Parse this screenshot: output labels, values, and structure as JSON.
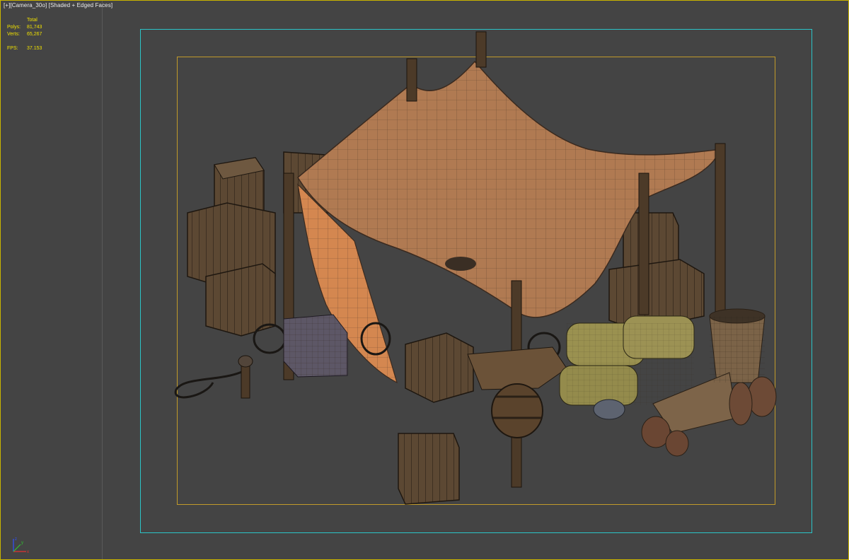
{
  "viewport": {
    "header": {
      "plus_label": "[+]",
      "camera_label": "[Camera_30o]",
      "shading_label": "[Shaded + Edged Faces]"
    },
    "stats": {
      "total_label": "Total",
      "polys_label": "Polys:",
      "polys_value": "81,743",
      "verts_label": "Verts:",
      "verts_value": "65,267",
      "fps_label": "FPS:",
      "fps_value": "37.153"
    },
    "axis_gizmo": {
      "x_label": "x",
      "y_label": "y",
      "z_label": "z"
    }
  },
  "colors": {
    "viewport_bg": "#444444",
    "stats_text": "#f0e100",
    "safe_frame": "#2bc4c8",
    "render_frame": "#c19a2a",
    "tent_cloth": "#b57b52",
    "wood": "#5e4a35",
    "sacks": "#8f864c"
  },
  "scene": {
    "description_icon": "tent-merchant-camp-model"
  }
}
